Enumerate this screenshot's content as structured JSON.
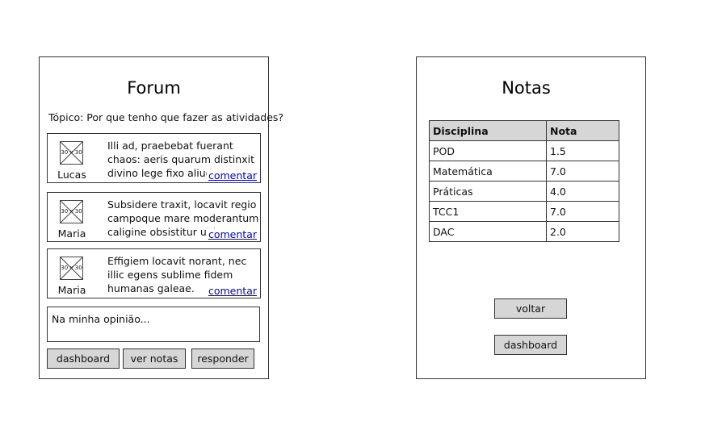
{
  "forum": {
    "title": "Forum",
    "topic": "Tópico: Por que tenho que fazer as atividades?",
    "avatar_placeholder": "30 x 30",
    "posts": [
      {
        "author": "Lucas",
        "text": "Illi ad, praebebat fuerant chaos: aeris quarum distinxit divino lege fixo aliud.",
        "link": "comentar"
      },
      {
        "author": "Maria",
        "text": "Subsidere traxit, locavit regio campoque mare moderantum caligine obsistitur ubi.",
        "link": "comentar"
      },
      {
        "author": "Maria",
        "text": "Effigiem locavit norant, nec illic egens sublime fidem humanas galeae.",
        "link": "comentar"
      }
    ],
    "reply_input": "Na minha opinião...",
    "buttons": {
      "dashboard": "dashboard",
      "ver_notas": "ver notas",
      "responder": "responder"
    }
  },
  "notas": {
    "title": "Notas",
    "columns": [
      "Disciplina",
      "Nota"
    ],
    "rows": [
      [
        "POD",
        "1.5"
      ],
      [
        "Matemática",
        "7.0"
      ],
      [
        "Práticas",
        "4.0"
      ],
      [
        "TCC1",
        "7.0"
      ],
      [
        "DAC",
        "2.0"
      ]
    ],
    "buttons": {
      "voltar": "voltar",
      "dashboard": "dashboard"
    }
  }
}
